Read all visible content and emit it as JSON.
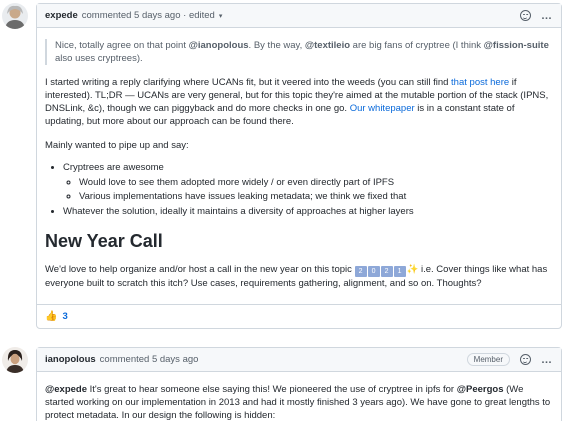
{
  "comment1": {
    "author": "expede",
    "meta": "commented 5 days ago · edited",
    "caret": "▾",
    "more": "…",
    "quote": {
      "t1": "Nice, totally agree on that point ",
      "m1": "@ianopolous",
      "t2": ". By the way, ",
      "m2": "@textileio",
      "t3": " are big fans of cryptree (I think ",
      "m3": "@fission-suite",
      "t4": " also uses cryptrees)."
    },
    "para1": {
      "t1": "I started writing a reply clarifying where UCANs fit, but it veered into the weeds (you can still find ",
      "link1": "that post here",
      "t2": " if interested). TL;DR — UCANs are very general, but for this topic they're aimed at the mutable portion of the stack (IPNS, DNSLink, &c), though we can piggyback and do more checks in one go. ",
      "link2": "Our whitepaper",
      "t3": " is in a constant state of updating, but more about our approach can be found there."
    },
    "para2": "Mainly wanted to pipe up and say:",
    "bullets": {
      "b1": "Cryptrees are awesome",
      "sub1": "Would love to see them adopted more widely / or even directly part of IPFS",
      "sub2": "Various implementations have issues leaking metadata; we think we fixed that",
      "b2": "Whatever the solution, ideally it maintains a diversity of approaches at higher layers"
    },
    "heading": "New Year Call",
    "para3": {
      "t1": "We'd love to help organize and/or host a call in the new year on this topic ",
      "d1": "2",
      "d2": "0",
      "d3": "2",
      "d4": "1",
      "spark": "✨",
      "t2": " i.e. Cover things like what has everyone built to scratch this itch? Use cases, requirements gathering, alignment, and so on. Thoughts?"
    },
    "reaction": {
      "emoji": "👍",
      "count": "3"
    }
  },
  "comment2": {
    "author": "ianopolous",
    "meta": "commented 5 days ago",
    "badge": "Member",
    "more": "…",
    "body": {
      "m1": "@expede",
      "t1": " It's great to hear someone else saying this! We pioneered the use of cryptree in ipfs for ",
      "m2": "@Peergos",
      "t2": " (We started working on our implementation in 2013 and had it mostly finished 3 years ago). We have gone to great lengths to protect metadata. In our design the following is hidden:"
    }
  },
  "colors": {
    "link": "#0969da",
    "border": "#d0d7de",
    "header_bg": "#f6f8fa"
  }
}
